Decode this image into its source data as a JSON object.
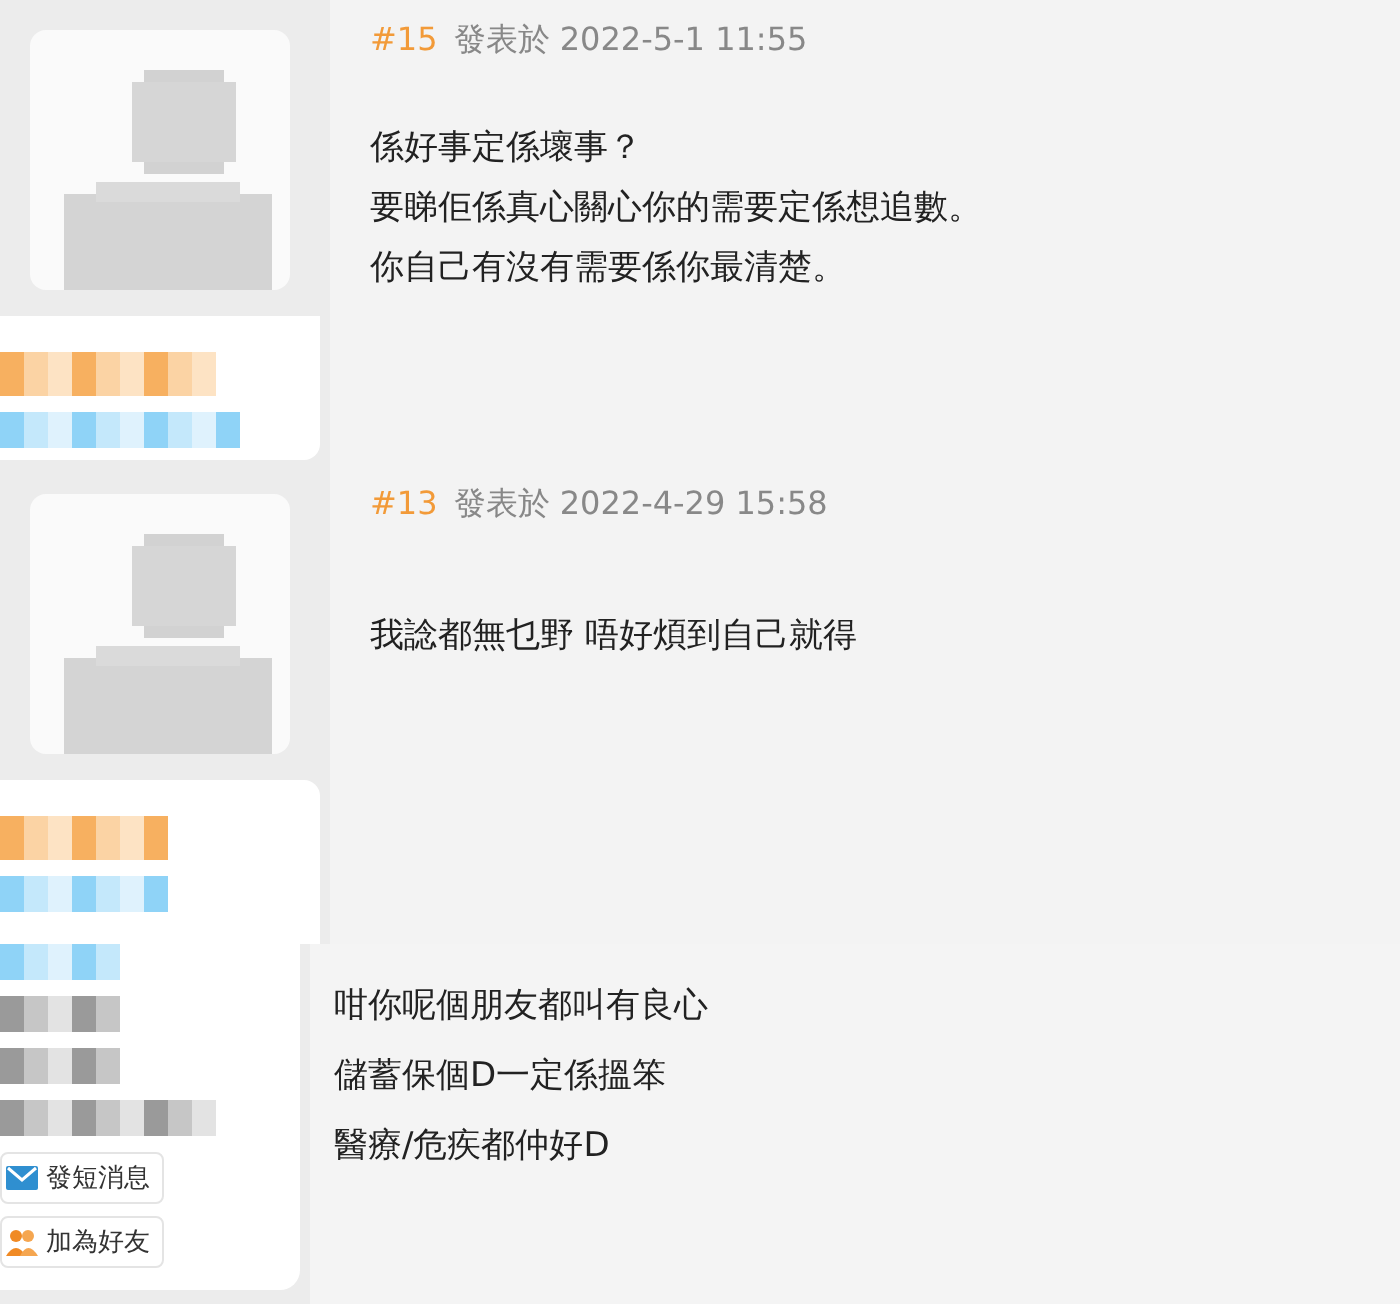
{
  "posts": [
    {
      "floor": "#15",
      "posted": "發表於 2022-5-1 11:55",
      "lines": [
        "係好事定係壞事？",
        "要睇佢係真心關心你的需要定係想追數。",
        "你自己有沒有需要係你最清楚。"
      ],
      "redacted": [
        {
          "kind": "name"
        },
        {
          "kind": "title"
        }
      ]
    },
    {
      "floor": "#13",
      "posted": "發表於 2022-4-29 15:58",
      "lines": [
        "我諗都無乜野  唔好煩到自己就得"
      ],
      "redacted": [
        {
          "kind": "name"
        },
        {
          "kind": "title"
        },
        {
          "kind": "title"
        },
        {
          "kind": "info"
        },
        {
          "kind": "info"
        },
        {
          "kind": "info"
        }
      ],
      "actions": [
        {
          "kind": "message",
          "label": "發短消息"
        },
        {
          "kind": "friend",
          "label": "加為好友"
        }
      ]
    }
  ],
  "quote": {
    "lines": [
      "咁你呢個朋友都叫有良心",
      "儲蓄保個D一定係搵笨",
      "醫療/危疾都仲好D"
    ]
  }
}
